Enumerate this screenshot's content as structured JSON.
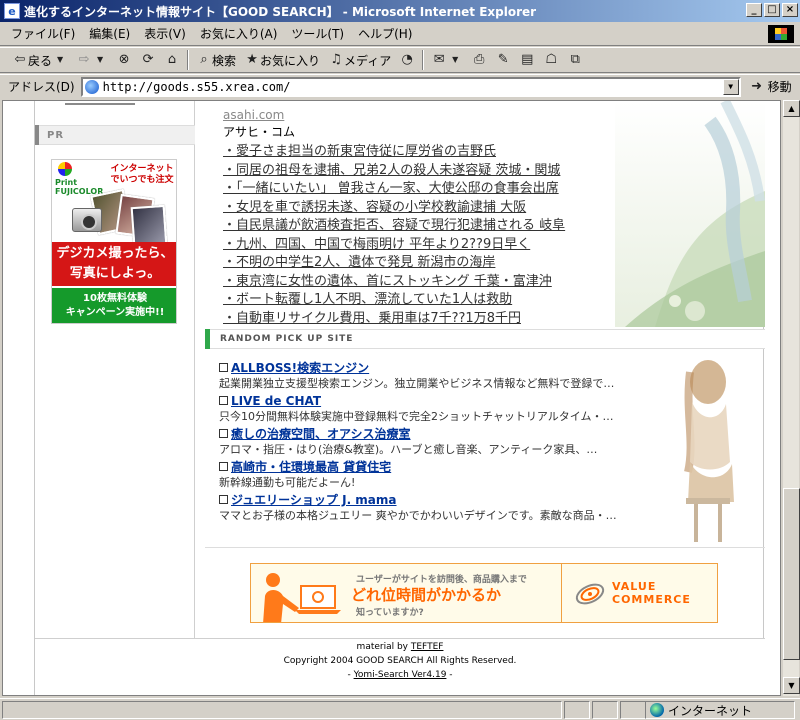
{
  "window": {
    "title": "進化するインターネット情報サイト【GOOD SEARCH】 - Microsoft Internet Explorer",
    "app_icon": "ie-page-icon"
  },
  "menubar": {
    "items": [
      {
        "label": "ファイル(F)"
      },
      {
        "label": "編集(E)"
      },
      {
        "label": "表示(V)"
      },
      {
        "label": "お気に入り(A)"
      },
      {
        "label": "ツール(T)"
      },
      {
        "label": "ヘルプ(H)"
      }
    ]
  },
  "toolbar": {
    "back_label": "戻る",
    "search_label": "検索",
    "favorites_label": "お気に入り",
    "media_label": "メディア"
  },
  "address": {
    "label": "アドレス(D)",
    "url": "http://goods.s55.xrea.com/",
    "go_label": "移動"
  },
  "left": {
    "pr_label": "PR",
    "ad": {
      "logo_text": "Print FUJICOLOR",
      "slogan": "インターネットでいつでも注文",
      "headline_1": "デジカメ撮ったら、",
      "headline_2": "写真にしよっ。",
      "campaign_1": "10枚無料体験",
      "campaign_2": "キャンペーン実施中!!"
    }
  },
  "news": {
    "source_link": "asahi.com",
    "source_name": "アサヒ・コム",
    "items": [
      "・愛子さま担当の新東宮侍従に厚労省の吉野氏",
      "・同居の祖母を逮捕、兄弟2人の殺人未遂容疑 茨城・関城",
      "・「一緒にいたい」 曽我さん一家、大使公邸の食事会出席",
      "・女児を車で誘拐未遂、容疑の小学校教諭逮捕 大阪",
      "・自民県議が飲酒検査拒否、容疑で現行犯逮捕される 岐阜",
      "・九州、四国、中国で梅雨明け 平年より2??9日早く",
      "・不明の中学生2人、遺体で発見 新潟市の海岸",
      "・東京湾に女性の遺体、首にストッキング 千葉・富津沖",
      "・ボート転覆し1人不明、漂流していた1人は救助",
      "・自動車リサイクル費用、乗用車は7千??1万8千円"
    ]
  },
  "random_pick": {
    "heading": "RANDOM PICK UP SITE",
    "items": [
      {
        "title": "ALLBOSS!検索エンジン",
        "desc": "起業開業独立支援型検索エンジン。独立開業やビジネス情報など無料で登録で…"
      },
      {
        "title": "LIVE de CHAT",
        "desc": "只今10分間無料体験実施中登録無料で完全2ショットチャットリアルタイム・…"
      },
      {
        "title": "癒しの治療空間、オアシス治療室",
        "desc": "アロマ・指圧・はり(治療&教室)。ハーブと癒し音楽、アンティーク家具、…"
      },
      {
        "title": "高崎市・住環境最高 貸貸住宅",
        "desc": "新幹線通勤も可能だよーん!"
      },
      {
        "title": "ジュエリーショップ J. mama",
        "desc": "ママとお子様の本格ジュエリー 爽やかでかわいいデザインです。素敵な商品・…"
      }
    ]
  },
  "banner": {
    "line1": "ユーザーがサイトを訪問後、商品購入まで",
    "line2": "どれ位時間がかかるか",
    "line3": "知っていますか?",
    "logo_line1": "VALUE",
    "logo_line2": "COMMERCE"
  },
  "footer": {
    "material_prefix": "material by ",
    "material_link": "TEFTEF",
    "copyright": "Copyright 2004 GOOD SEARCH All Rights Reserved.",
    "dash_left": "- ",
    "engine_link": "Yomi-Search Ver4.19",
    "dash_right": " -"
  },
  "status": {
    "zone_label": "インターネット"
  },
  "colors": {
    "title_gradient_start": "#0a246a",
    "pick_link": "#003399",
    "random_marker": "#2fa84a",
    "banner_accent": "#ff6600"
  }
}
